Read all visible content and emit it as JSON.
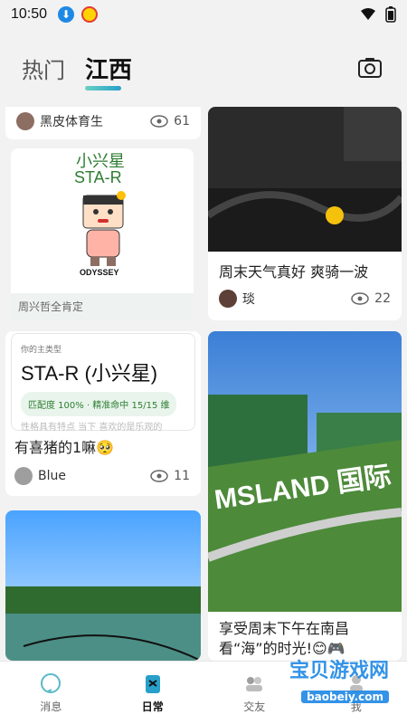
{
  "status": {
    "time": "10:50"
  },
  "header": {
    "tabs": [
      {
        "label": "热门"
      },
      {
        "label": "江西"
      }
    ],
    "active_tab": "江西"
  },
  "feed": {
    "left": [
      {
        "author": "黑皮体育生",
        "views": "61"
      },
      {
        "title": "小兴星",
        "code": "STA-R",
        "brand": "ODYSSEY",
        "caption": "周兴哲全肯定"
      },
      {
        "top_label": "你的主类型",
        "type_title": "STA-R (小兴星)",
        "match": "匹配度 100% · 精准命中 15/15 维",
        "bottom_fade": "性格具有特点 当下 喜欢的是乐观的",
        "post_title": "有喜猪的1嘛🥺",
        "author": "Blue",
        "views": "11"
      }
    ],
    "right": [
      {
        "title": "周末天气真好 爽骑一波",
        "author": "琰",
        "views": "22"
      },
      {
        "image_text": "MSLAND 国际",
        "title": "享受周末下午在南昌看“海”的时光!😊🎮"
      }
    ]
  },
  "nav": {
    "items": [
      {
        "label": "消息"
      },
      {
        "label": "日常"
      },
      {
        "label": "交友"
      },
      {
        "label": "我"
      }
    ],
    "active": "日常"
  },
  "watermark": {
    "main": "宝贝游戏网",
    "sub": "baobeiy.com"
  },
  "colors": {
    "accent": "#28a0c9",
    "card_bg": "#ffffff",
    "bg": "#f2f2f2"
  }
}
